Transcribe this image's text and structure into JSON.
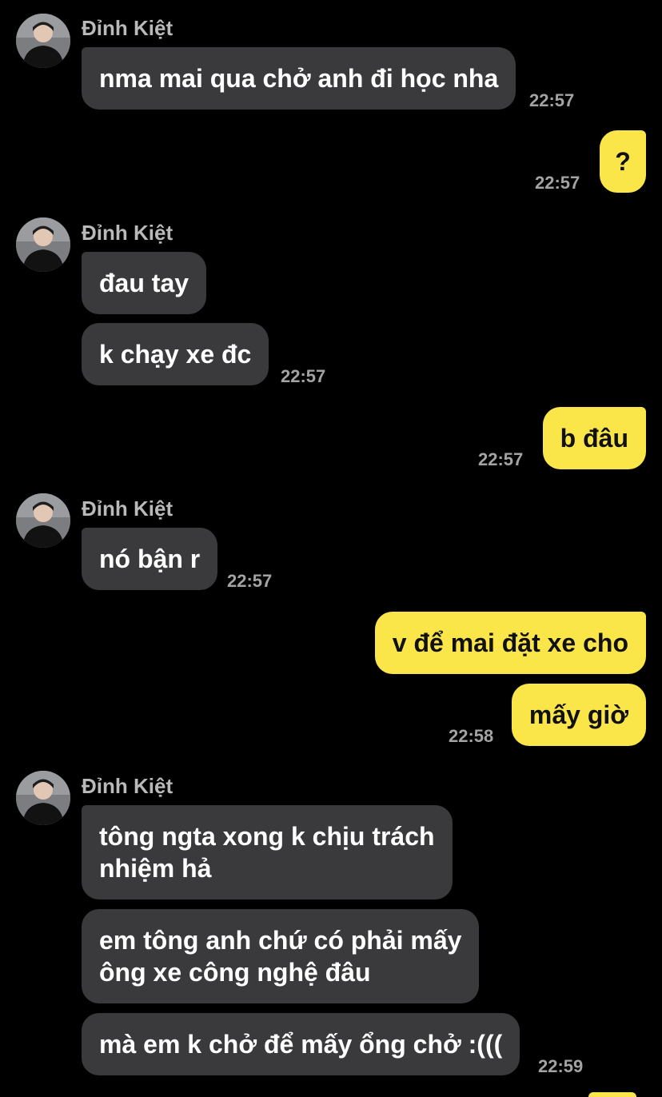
{
  "contact": {
    "name": "Đỉnh Kiệt"
  },
  "groups": [
    {
      "sender": "Đỉnh Kiệt",
      "messages": [
        "nma mai qua chở anh đi học nha"
      ],
      "time": "22:57"
    },
    {
      "sender": "me",
      "messages": [
        "?"
      ],
      "time": "22:57"
    },
    {
      "sender": "Đỉnh Kiệt",
      "messages": [
        "đau tay",
        "k chạy xe đc"
      ],
      "time": "22:57"
    },
    {
      "sender": "me",
      "messages": [
        "b đâu"
      ],
      "time": "22:57"
    },
    {
      "sender": "Đỉnh Kiệt",
      "messages": [
        "nó bận r"
      ],
      "time": "22:57"
    },
    {
      "sender": "me",
      "messages": [
        "v để mai đặt xe cho",
        "mấy giờ"
      ],
      "time": "22:58"
    },
    {
      "sender": "Đỉnh Kiệt",
      "messages": [
        "tông ngta xong k chịu trách\nnhiệm hả",
        "em tông anh chứ có phải mấy\nông xe công nghệ đâu",
        "mà em k chở để mấy ổng chở :((("
      ],
      "time": "22:59"
    }
  ],
  "colors": {
    "background": "#000000",
    "incoming_bubble": "#3a3a3c",
    "outgoing_bubble": "#fbe64a",
    "timestamp": "#a3a3a3"
  },
  "icons": {
    "avatar": "profile-photo"
  }
}
